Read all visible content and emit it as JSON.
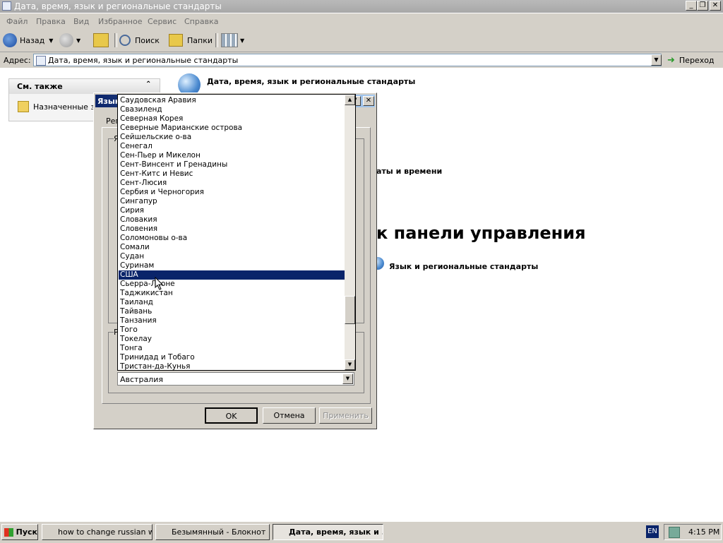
{
  "window": {
    "title": "Дата, время, язык и региональные стандарты"
  },
  "menu": {
    "items": [
      "Файл",
      "Правка",
      "Вид",
      "Избранное",
      "Сервис",
      "Справка"
    ]
  },
  "toolbar": {
    "back_label": "Назад",
    "search_label": "Поиск",
    "folders_label": "Папки"
  },
  "address": {
    "label": "Адрес:",
    "value": "Дата, время, язык и региональные стандарты",
    "go_label": "Переход"
  },
  "see_also": {
    "title": "См. также",
    "item": "Назначенные за"
  },
  "content": {
    "header": "Дата, время, язык и региональные стандарты",
    "partial_text": "аты и времени",
    "big_title": "к панели управления",
    "link": "Язык и региональные стандарты"
  },
  "dialog": {
    "title": "Язык",
    "tab_partial": "Рег",
    "group_partial_1": "Я",
    "group_partial_2": "Р",
    "ok_label": "OK",
    "cancel_label": "Отмена",
    "apply_label": "Применить"
  },
  "country_list": {
    "items": [
      "Саудовская Аравия",
      "Свазиленд",
      "Северная Корея",
      "Северные Марианские острова",
      "Сейшельские о-ва",
      "Сенегал",
      "Сен-Пьер и Микелон",
      "Сент-Винсент и Гренадины",
      "Сент-Китс и Невис",
      "Сент-Люсия",
      "Сербия и Черногория",
      "Сингапур",
      "Сирия",
      "Словакия",
      "Словения",
      "Соломоновы о-ва",
      "Сомали",
      "Судан",
      "Суринам",
      "США",
      "Сьерра-Леоне",
      "Таджикистан",
      "Таиланд",
      "Тайвань",
      "Танзания",
      "Того",
      "Токелау",
      "Тонга",
      "Тринидад и Тобаго",
      "Тристан-да-Кунья"
    ],
    "selected": "США"
  },
  "combo": {
    "value": "Австралия"
  },
  "taskbar": {
    "start_label": "Пуск",
    "tasks": [
      "how to change russian w...",
      "Безымянный - Блокнот",
      "Дата, время, язык и ..."
    ],
    "lang": "EN",
    "clock": "4:15 PM"
  },
  "colors": {
    "selection": "#0a246a",
    "dialog_face": "#d4d0c8",
    "title_active": "#0a246a"
  },
  "icons": [
    "control-panel-icon",
    "back-arrow-icon",
    "forward-arrow-icon",
    "up-folder-icon",
    "search-icon",
    "folders-icon",
    "views-icon",
    "go-arrow-icon",
    "scheduled-tasks-icon",
    "globe-icon",
    "windows-flag-icon",
    "mouse-cursor-icon"
  ]
}
